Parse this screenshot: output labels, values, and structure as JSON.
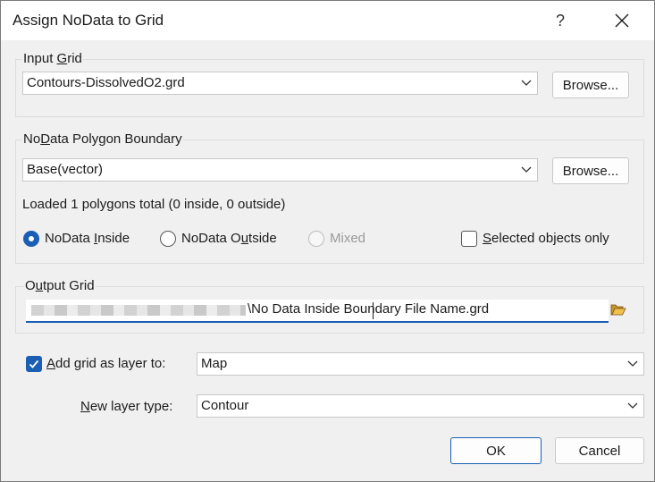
{
  "window": {
    "title": "Assign NoData to Grid",
    "help_label": "?",
    "close_icon": "close-icon"
  },
  "input_grid": {
    "label_pre": "Input ",
    "label_key": "G",
    "label_post": "rid",
    "value": "Contours-DissolvedO2.grd",
    "browse_label": "Browse..."
  },
  "boundary": {
    "label_pre": "No",
    "label_key": "D",
    "label_post": "ata Polygon Boundary",
    "value": "Base(vector)",
    "browse_label": "Browse...",
    "status": "Loaded 1 polygons total (0 inside, 0 outside)",
    "opt_inside_pre": "NoData ",
    "opt_inside_key": "I",
    "opt_inside_post": "nside",
    "opt_outside_pre": "NoData O",
    "opt_outside_key": "u",
    "opt_outside_post": "tside",
    "opt_mixed": "Mixed",
    "selected_pre": "",
    "selected_key": "S",
    "selected_post": "elected objects only",
    "selected_value": "NoData Inside"
  },
  "output_grid": {
    "label_pre": "O",
    "label_key": "u",
    "label_post": "tput Grid",
    "path_visible": "\\No Data Inside Boundary File Name.grd",
    "folder_icon": "folder-open-icon"
  },
  "layer": {
    "add_pre": "",
    "add_key": "A",
    "add_post": "dd grid as layer to:",
    "add_checked": true,
    "add_value": "Map",
    "type_pre": "",
    "type_key": "N",
    "type_post": "ew layer type:",
    "type_value": "Contour"
  },
  "footer": {
    "ok_label": "OK",
    "cancel_label": "Cancel"
  },
  "colors": {
    "accent": "#1a5fb4",
    "background": "#f0f0f0"
  }
}
